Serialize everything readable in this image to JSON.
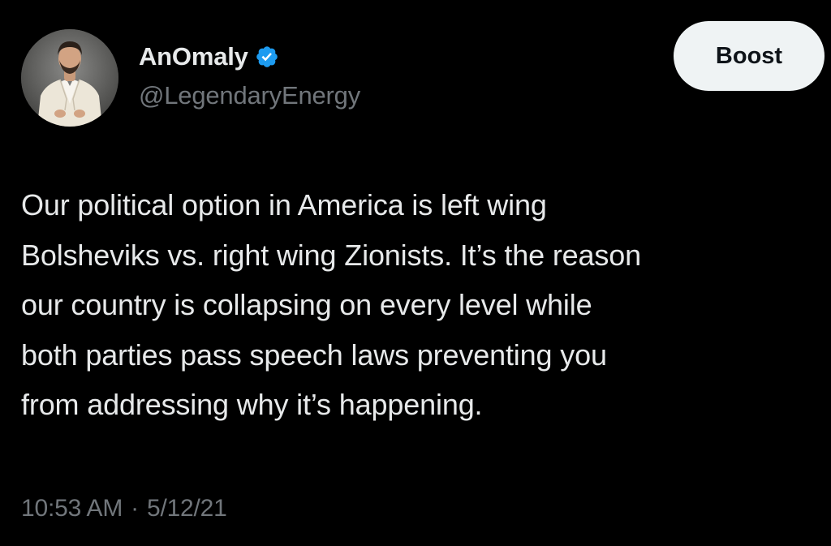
{
  "author": {
    "display_name": "AnOmaly",
    "handle": "@LegendaryEnergy",
    "verified": true,
    "verified_color": "#1d9bf0"
  },
  "header": {
    "action_label": "Boost"
  },
  "tweet": {
    "lines": [
      "Our political option in America is left wing",
      "Bolsheviks vs. right wing Zionists. It’s the reason",
      "our country is collapsing on every level while",
      "both parties pass speech laws preventing you",
      "from addressing why it’s happening."
    ]
  },
  "meta": {
    "time": "10:53 AM",
    "separator": "·",
    "date": "5/12/21"
  },
  "colors": {
    "background": "#000000",
    "primary_text": "#e7e9ea",
    "secondary_text": "#71767b",
    "button_bg": "#eff3f4",
    "button_text": "#0f1419"
  }
}
